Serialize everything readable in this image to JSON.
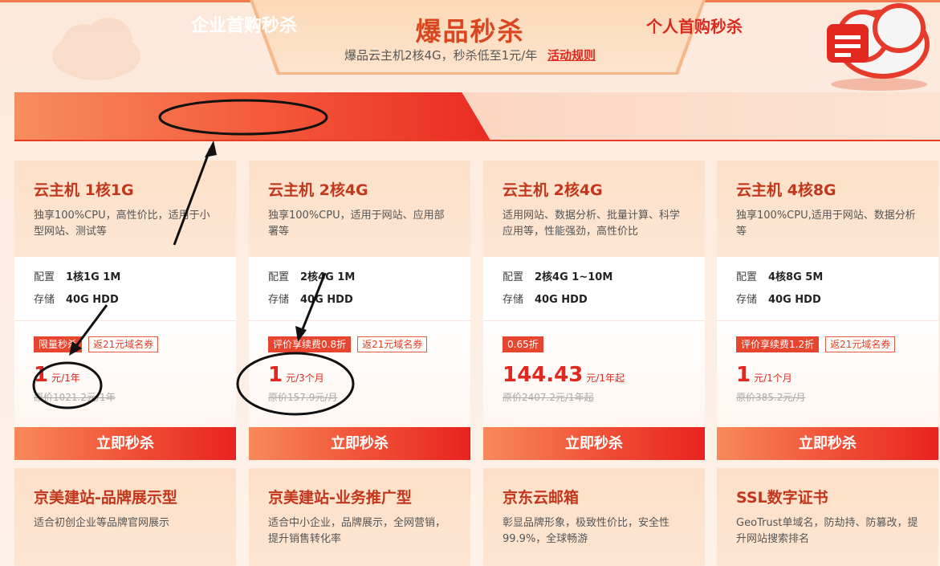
{
  "banner": {
    "title": "爆品秒杀",
    "subtitle": "爆品云主机2核4G，秒杀低至1元/年",
    "rules_link": "活动规则"
  },
  "tabs": [
    {
      "label": "企业首购秒杀",
      "active": true
    },
    {
      "label": "个人首购秒杀",
      "active": false
    }
  ],
  "products": [
    {
      "title": "云主机 1核1G",
      "desc": "独享100%CPU，高性价比，适用于小型网站、测试等",
      "spec_label_1": "配置",
      "spec_value_1": "1核1G 1M",
      "spec_label_2": "存储",
      "spec_value_2": "40G HDD",
      "badge": "限量秒杀",
      "coupon": "返21元域名券",
      "price": "1",
      "price_unit": "元/1年",
      "original": "原价1021.2元/1年",
      "button": "立即秒杀"
    },
    {
      "title": "云主机 2核4G",
      "desc": "独享100%CPU，适用于网站、应用部署等",
      "spec_label_1": "配置",
      "spec_value_1": "2核4G 1M",
      "spec_label_2": "存储",
      "spec_value_2": "40G HDD",
      "badge": "评价享续费0.8折",
      "coupon": "返21元域名券",
      "price": "1",
      "price_unit": "元/3个月",
      "original": "原价157.9元/月",
      "button": "立即秒杀"
    },
    {
      "title": "云主机 2核4G",
      "desc": "适用网站、数据分析、批量计算、科学应用等，性能强劲，高性价比",
      "spec_label_1": "配置",
      "spec_value_1": "2核4G 1~10M",
      "spec_label_2": "存储",
      "spec_value_2": "40G HDD",
      "badge": "0.65折",
      "coupon": "",
      "price": "144.43",
      "price_unit": "元/1年起",
      "original": "原价2407.2元/1年起",
      "button": "立即秒杀"
    },
    {
      "title": "云主机 4核8G",
      "desc": "独享100%CPU,适用于网站、数据分析等",
      "spec_label_1": "配置",
      "spec_value_1": "4核8G 5M",
      "spec_label_2": "存储",
      "spec_value_2": "40G HDD",
      "badge": "评价享续费1.2折",
      "coupon": "返21元域名券",
      "price": "1",
      "price_unit": "元/1个月",
      "original": "原价385.2元/月",
      "button": "立即秒杀"
    }
  ],
  "products_row2": [
    {
      "title": "京美建站-品牌展示型",
      "desc": "适合初创企业等品牌官网展示"
    },
    {
      "title": "京美建站-业务推广型",
      "desc": "适合中小企业，品牌展示，全网营销，提升销售转化率"
    },
    {
      "title": "京东云邮箱",
      "desc": "彰显品牌形象，极致性价比，安全性99.9%，全球畅游"
    },
    {
      "title": "SSL数字证书",
      "desc": "GeoTrust单域名，防劫持、防篡改，提升网站搜索排名"
    }
  ],
  "colors": {
    "accent": "#e0281e",
    "title": "#c2361b",
    "banner_title": "#d9461f"
  }
}
